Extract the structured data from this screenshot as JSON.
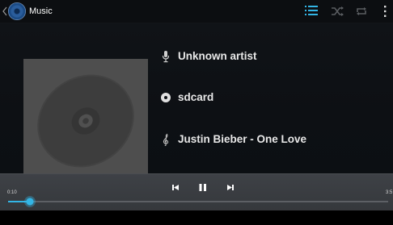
{
  "app": {
    "title": "Music"
  },
  "actionbar": {
    "icons": [
      "up-caret-icon",
      "music-app-icon",
      "playlist-icon",
      "shuffle-icon",
      "repeat-icon",
      "overflow-menu-icon"
    ],
    "accent_color": "#33b5e5",
    "inactive_color": "#5a5d61"
  },
  "track": {
    "artist": "Unknown artist",
    "album": "sdcard",
    "title": "Justin Bieber - One Love",
    "artist_icon": "microphone-icon",
    "album_icon": "disc-icon",
    "title_icon": "treble-clef-icon",
    "artwork_icon": "default-album-art-disc"
  },
  "player": {
    "current_time": "0:10",
    "total_time": "3:5",
    "progress": 0.057,
    "controls": [
      "previous-icon",
      "pause-icon",
      "next-icon"
    ]
  }
}
